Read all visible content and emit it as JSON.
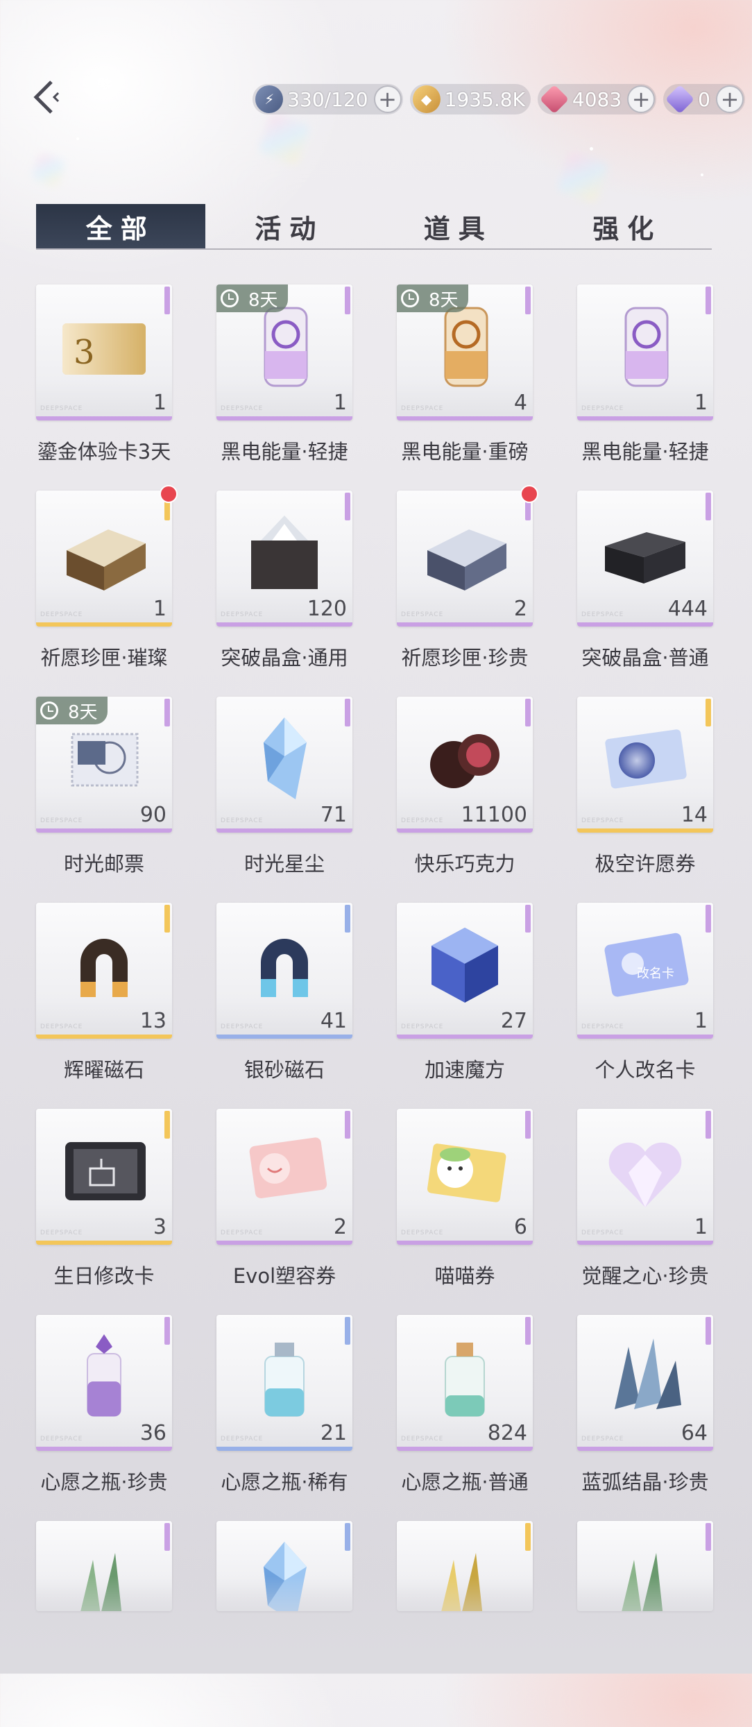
{
  "header": {
    "currencies": [
      {
        "id": "energy",
        "value": "330/120",
        "icon": "lightning-icon"
      },
      {
        "id": "gold",
        "value": "1935.8K",
        "icon": "gold-coin-icon"
      },
      {
        "id": "ruby",
        "value": "4083",
        "icon": "ruby-diamond-icon"
      },
      {
        "id": "gem",
        "value": "0",
        "icon": "purple-diamond-icon"
      }
    ],
    "plus_label": "+"
  },
  "tabs": [
    {
      "label": "全部",
      "active": true
    },
    {
      "label": "活动",
      "active": false
    },
    {
      "label": "道具",
      "active": false
    },
    {
      "label": "强化",
      "active": false
    }
  ],
  "brand_mark": "DEEPSPACE",
  "items": [
    {
      "name": "鎏金体验卡3天",
      "qty": "1",
      "rarity": "purple",
      "timer": "",
      "dot": false,
      "icon": "gold-card-icon"
    },
    {
      "name": "黑电能量·轻捷",
      "qty": "1",
      "rarity": "purple",
      "timer": "8天",
      "dot": false,
      "icon": "energy-drink-can-icon"
    },
    {
      "name": "黑电能量·重磅",
      "qty": "4",
      "rarity": "purple",
      "timer": "8天",
      "dot": false,
      "icon": "gold-drink-can-icon"
    },
    {
      "name": "黑电能量·轻捷",
      "qty": "1",
      "rarity": "purple",
      "timer": "",
      "dot": false,
      "icon": "energy-drink-can-icon"
    },
    {
      "name": "祈愿珍匣·璀璨",
      "qty": "1",
      "rarity": "gold",
      "timer": "",
      "dot": true,
      "icon": "gold-box-icon"
    },
    {
      "name": "突破晶盒·通用",
      "qty": "120",
      "rarity": "purple",
      "timer": "",
      "dot": false,
      "icon": "crystal-box-icon"
    },
    {
      "name": "祈愿珍匣·珍贵",
      "qty": "2",
      "rarity": "purple",
      "timer": "",
      "dot": true,
      "icon": "silver-box-icon"
    },
    {
      "name": "突破晶盒·普通",
      "qty": "444",
      "rarity": "purple",
      "timer": "",
      "dot": false,
      "icon": "black-box-icon"
    },
    {
      "name": "时光邮票",
      "qty": "90",
      "rarity": "purple",
      "timer": "8天",
      "dot": false,
      "icon": "stamp-icon"
    },
    {
      "name": "时光星尘",
      "qty": "71",
      "rarity": "purple",
      "timer": "",
      "dot": false,
      "icon": "blue-crystal-icon"
    },
    {
      "name": "快乐巧克力",
      "qty": "11100",
      "rarity": "purple",
      "timer": "",
      "dot": false,
      "icon": "chocolate-icon"
    },
    {
      "name": "极空许愿券",
      "qty": "14",
      "rarity": "gold",
      "timer": "",
      "dot": false,
      "icon": "wish-ticket-icon"
    },
    {
      "name": "辉曜磁石",
      "qty": "13",
      "rarity": "gold",
      "timer": "",
      "dot": false,
      "icon": "gold-magnet-icon"
    },
    {
      "name": "银砂磁石",
      "qty": "41",
      "rarity": "blue",
      "timer": "",
      "dot": false,
      "icon": "blue-magnet-icon"
    },
    {
      "name": "加速魔方",
      "qty": "27",
      "rarity": "purple",
      "timer": "",
      "dot": false,
      "icon": "cube-icon"
    },
    {
      "name": "个人改名卡",
      "qty": "1",
      "rarity": "purple",
      "timer": "",
      "dot": false,
      "icon": "rename-card-icon"
    },
    {
      "name": "生日修改卡",
      "qty": "3",
      "rarity": "gold",
      "timer": "",
      "dot": false,
      "icon": "birthday-card-icon"
    },
    {
      "name": "Evol塑容券",
      "qty": "2",
      "rarity": "purple",
      "timer": "",
      "dot": false,
      "icon": "face-ticket-icon"
    },
    {
      "name": "喵喵券",
      "qty": "6",
      "rarity": "purple",
      "timer": "",
      "dot": false,
      "icon": "cat-ticket-icon"
    },
    {
      "name": "觉醒之心·珍贵",
      "qty": "1",
      "rarity": "purple",
      "timer": "",
      "dot": false,
      "icon": "crystal-heart-icon"
    },
    {
      "name": "心愿之瓶·珍贵",
      "qty": "36",
      "rarity": "purple",
      "timer": "",
      "dot": false,
      "icon": "purple-bottle-icon"
    },
    {
      "name": "心愿之瓶·稀有",
      "qty": "21",
      "rarity": "blue",
      "timer": "",
      "dot": false,
      "icon": "blue-bottle-icon"
    },
    {
      "name": "心愿之瓶·普通",
      "qty": "824",
      "rarity": "purple",
      "timer": "",
      "dot": false,
      "icon": "teal-bottle-icon"
    },
    {
      "name": "蓝弧结晶·珍贵",
      "qty": "64",
      "rarity": "purple",
      "timer": "",
      "dot": false,
      "icon": "blue-crystal-cluster-icon"
    },
    {
      "name": "",
      "qty": "",
      "rarity": "purple",
      "timer": "",
      "dot": false,
      "icon": "green-crystal-icon"
    },
    {
      "name": "",
      "qty": "",
      "rarity": "blue",
      "timer": "",
      "dot": false,
      "icon": "blue-crystal-icon"
    },
    {
      "name": "",
      "qty": "",
      "rarity": "gold",
      "timer": "",
      "dot": false,
      "icon": "gold-crystal-icon"
    },
    {
      "name": "",
      "qty": "",
      "rarity": "purple",
      "timer": "",
      "dot": false,
      "icon": "green-crystal-icon"
    }
  ],
  "colors": {
    "purple": "#c9a0e4",
    "gold": "#f3c65a",
    "blue": "#98b0e8",
    "accent": "#2c3546"
  }
}
